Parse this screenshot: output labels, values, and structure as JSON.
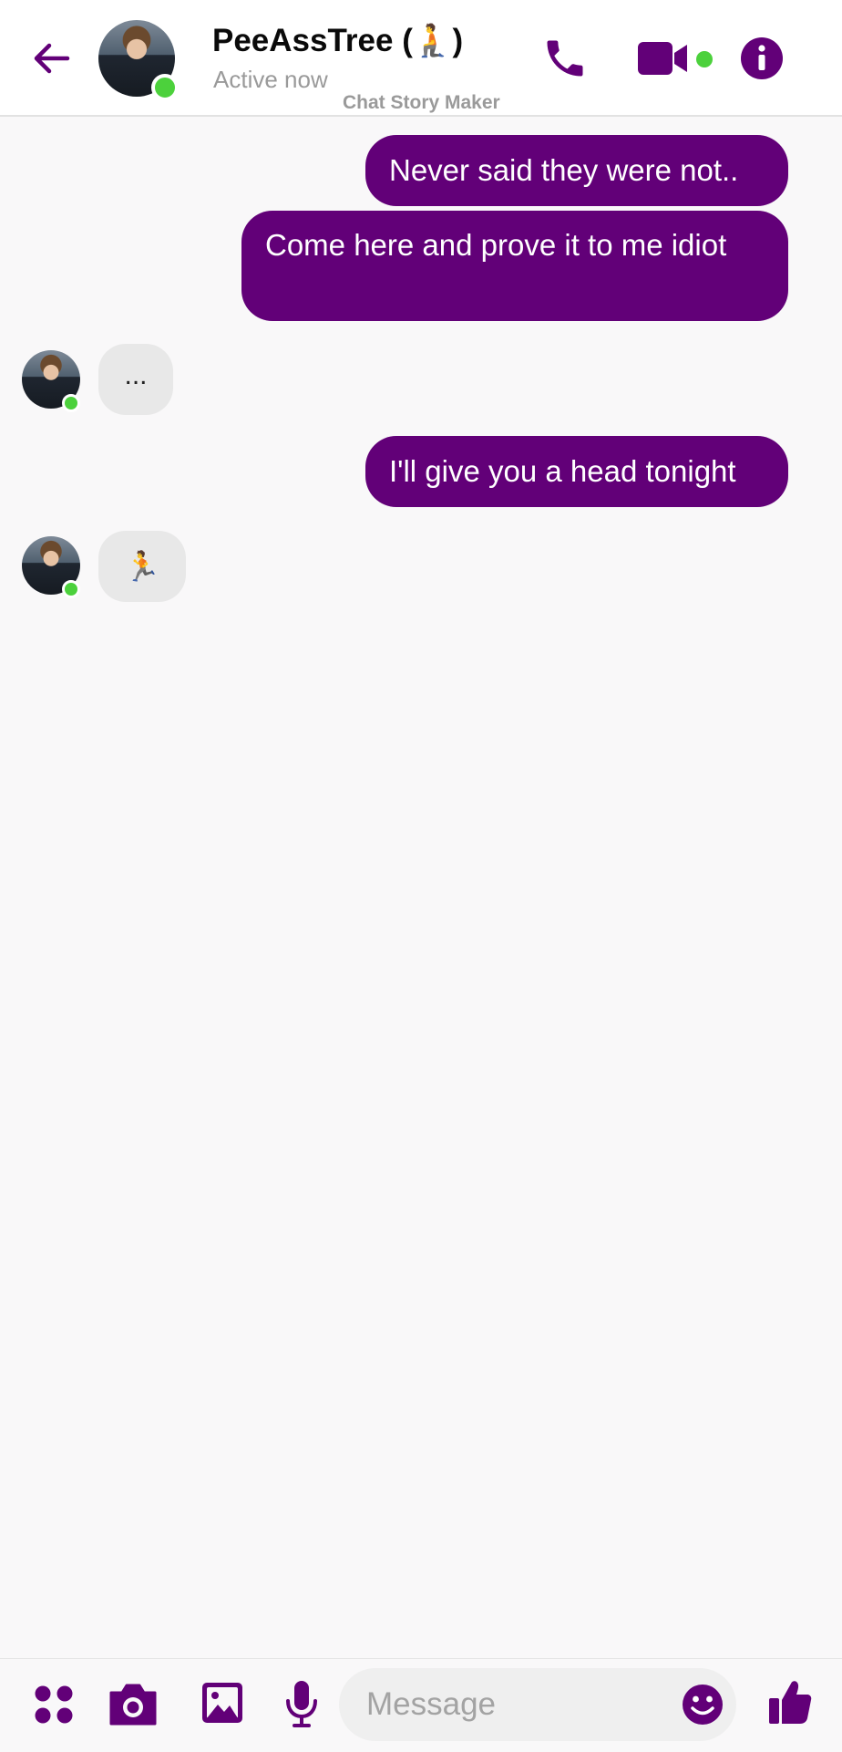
{
  "header": {
    "contact_name": "PeeAssTree (🧎)",
    "status": "Active now",
    "watermark": "Chat Story Maker"
  },
  "messages": [
    {
      "side": "sent",
      "text": "Never said they were not.."
    },
    {
      "side": "sent",
      "text": "Come here and prove it to me idiot"
    },
    {
      "side": "received",
      "text": "..."
    },
    {
      "side": "sent",
      "text": "I'll give you a head tonight"
    },
    {
      "side": "received",
      "text": "🏃"
    }
  ],
  "composer": {
    "placeholder": "Message"
  },
  "colors": {
    "accent": "#620078",
    "online": "#4cd13c",
    "received_bubble": "#e8e8e8",
    "background": "#f9f8f9"
  },
  "icons": [
    "back-arrow-icon",
    "phone-icon",
    "video-camera-icon",
    "info-icon",
    "apps-icon",
    "camera-icon",
    "gallery-icon",
    "microphone-icon",
    "emoji-icon",
    "thumbs-up-icon"
  ]
}
